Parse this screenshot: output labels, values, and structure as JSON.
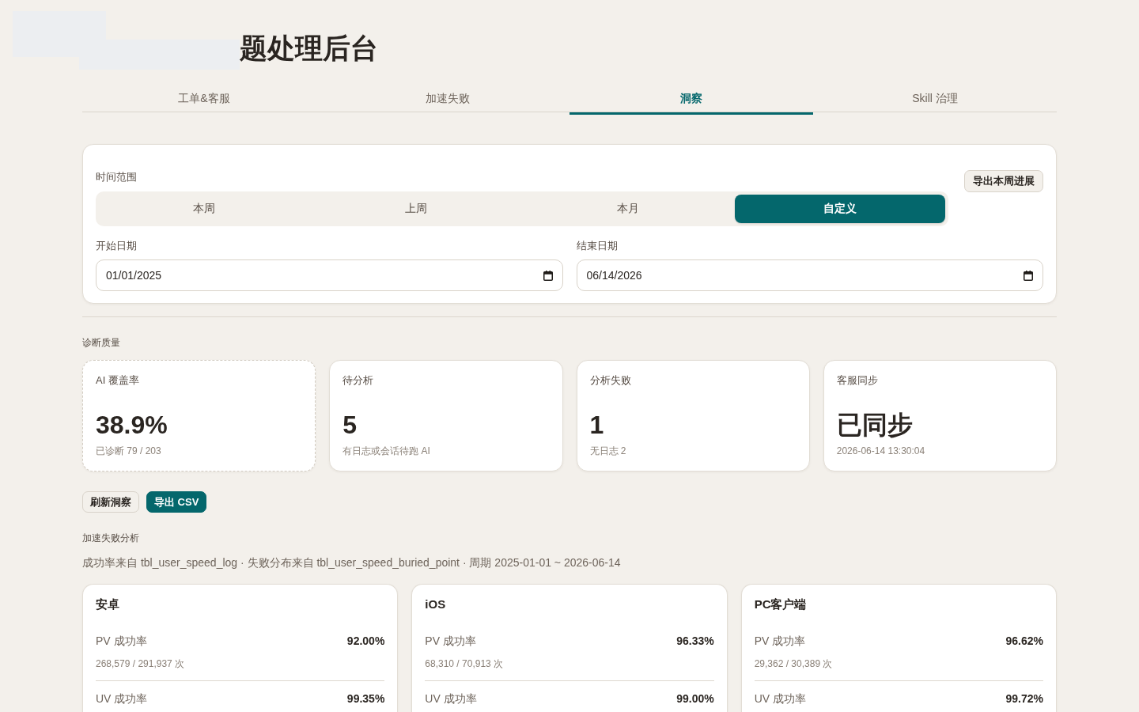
{
  "header": {
    "title": "题处理后台"
  },
  "tabs": [
    {
      "label": "工单&客服",
      "selected": false
    },
    {
      "label": "加速失败",
      "selected": false
    },
    {
      "label": "洞察",
      "selected": true
    },
    {
      "label": "Skill 治理",
      "selected": false
    }
  ],
  "time_range": {
    "label": "时间范围",
    "export_button": "导出本周进展",
    "options": [
      {
        "label": "本周",
        "selected": false
      },
      {
        "label": "上周",
        "selected": false
      },
      {
        "label": "本月",
        "selected": false
      },
      {
        "label": "自定义",
        "selected": true
      }
    ],
    "start_date": {
      "label": "开始日期",
      "value": "01/01/2025"
    },
    "end_date": {
      "label": "结束日期",
      "value": "06/14/2026"
    }
  },
  "diagnosis": {
    "heading": "诊断质量",
    "cards": [
      {
        "label": "AI 覆盖率",
        "value": "38.9%",
        "note": "已诊断 79 / 203",
        "highlighted": true
      },
      {
        "label": "待分析",
        "value": "5",
        "note": "有日志或会话待跑 AI",
        "highlighted": false
      },
      {
        "label": "分析失败",
        "value": "1",
        "note": "无日志 2",
        "highlighted": false
      },
      {
        "label": "客服同步",
        "value": "已同步",
        "note": "2026-06-14 13:30:04",
        "highlighted": false
      }
    ]
  },
  "actions": [
    {
      "label": "刷新洞察",
      "kind": "secondary"
    },
    {
      "label": "导出 CSV",
      "kind": "primary"
    }
  ],
  "speed_failure": {
    "heading": "加速失败分析",
    "source": "成功率来自 tbl_user_speed_log · 失败分布来自 tbl_user_speed_buried_point · 周期 2025-01-01 ~ 2026-06-14",
    "platforms": [
      {
        "name": "安卓",
        "metrics": [
          {
            "label": "PV 成功率",
            "value": "92.00%",
            "detail": "268,579 / 291,937 次"
          },
          {
            "label": "UV 成功率",
            "value": "99.35%"
          }
        ]
      },
      {
        "name": "iOS",
        "metrics": [
          {
            "label": "PV 成功率",
            "value": "96.33%",
            "detail": "68,310 / 70,913 次"
          },
          {
            "label": "UV 成功率",
            "value": "99.00%"
          }
        ]
      },
      {
        "name": "PC客户端",
        "metrics": [
          {
            "label": "PV 成功率",
            "value": "96.62%",
            "detail": "29,362 / 30,389 次"
          },
          {
            "label": "UV 成功率",
            "value": "99.72%"
          }
        ]
      }
    ]
  }
}
